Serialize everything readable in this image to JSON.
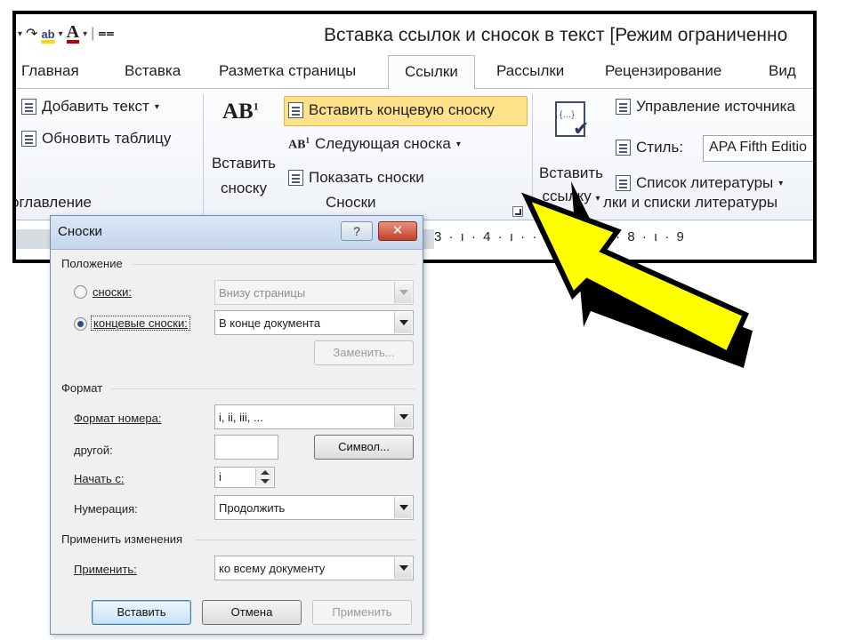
{
  "window": {
    "title": "Вставка ссылок и сносок в текст [Режим ограниченно"
  },
  "quick_access": {
    "redo_icon": "redo-icon",
    "spelling_label": "ab",
    "font_color_label": "A"
  },
  "tabs": [
    {
      "label": "Главная"
    },
    {
      "label": "Вставка"
    },
    {
      "label": "Разметка страницы"
    },
    {
      "label": "Ссылки"
    },
    {
      "label": "Рассылки"
    },
    {
      "label": "Рецензирование"
    },
    {
      "label": "Вид"
    }
  ],
  "ribbon": {
    "toc_group": {
      "add_text": "Добавить текст",
      "update_table": "Обновить таблицу",
      "label": "оглавление"
    },
    "footnotes_group": {
      "insert_footnote_line1": "Вставить",
      "insert_footnote_line2": "сноску",
      "insert_endnote": "Вставить концевую сноску",
      "next_footnote": "Следующая сноска",
      "show_notes": "Показать сноски",
      "label": "Сноски"
    },
    "citations_group": {
      "insert_citation_line1": "Вставить",
      "insert_citation_line2": "ссылку",
      "manage_sources": "Управление источника",
      "style_label": "Стиль:",
      "style_value": "APA Fifth Editio",
      "bibliography": "Список литературы",
      "label": "лки и списки литературы"
    },
    "ruler_text": "3 · ı · 4 · ı · · · ı · 7 · ı · 8 · ı · 9"
  },
  "dialog": {
    "title": "Сноски",
    "help": "?",
    "close": "✕",
    "position_section": "Положение",
    "footnotes_label": "сноски:",
    "footnotes_value": "Внизу страницы",
    "endnotes_label": "концевые сноски:",
    "endnotes_value": "В конце документа",
    "replace_button": "Заменить...",
    "format_section": "Формат",
    "number_format_label": "Формат номера:",
    "number_format_value": "i, ii, iii, ...",
    "custom_mark_label": "другой:",
    "symbol_button": "Символ...",
    "start_at_label": "Начать с:",
    "start_at_value": "i",
    "numbering_label": "Нумерация:",
    "numbering_value": "Продолжить",
    "apply_section": "Применить изменения",
    "apply_to_label": "Применить:",
    "apply_to_value": "ко всему документу",
    "insert_button": "Вставить",
    "cancel_button": "Отмена",
    "apply_button": "Применить",
    "footnotes_checked": false,
    "endnotes_checked": true
  },
  "colors": {
    "arrow_fill": "#ffff00",
    "arrow_outline": "#000000",
    "highlight": "#fde28a"
  }
}
